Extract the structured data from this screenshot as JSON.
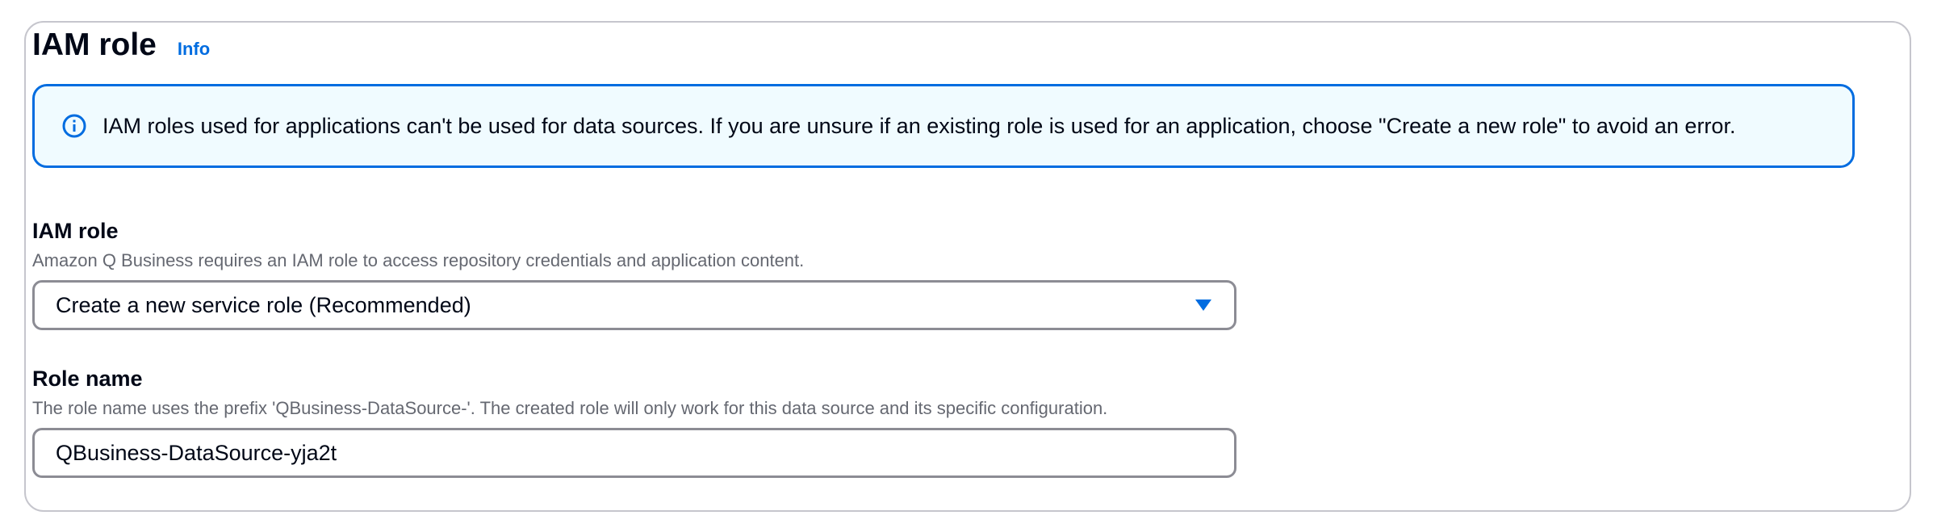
{
  "section": {
    "title": "IAM role",
    "info_link": "Info"
  },
  "alert": {
    "icon": "info-circle-icon",
    "message": "IAM roles used for applications can't be used for data sources. If you are unsure if an existing role is used for an application, choose \"Create a new role\" to avoid an error."
  },
  "iam_role_field": {
    "label": "IAM role",
    "description": "Amazon Q Business requires an IAM role to access repository credentials and application content.",
    "selected_value": "Create a new service role (Recommended)",
    "dropdown_icon": "caret-down-icon"
  },
  "role_name_field": {
    "label": "Role name",
    "description": "The role name uses the prefix 'QBusiness-DataSource-'. The created role will only work for this data source and its specific configuration.",
    "value": "QBusiness-DataSource-yja2t"
  },
  "colors": {
    "accent": "#006ce0",
    "alert_background": "#f0fbff",
    "panel_border": "#c6c6cd",
    "input_border": "#8c8c94",
    "description_text": "#656871",
    "primary_text": "#000716"
  }
}
